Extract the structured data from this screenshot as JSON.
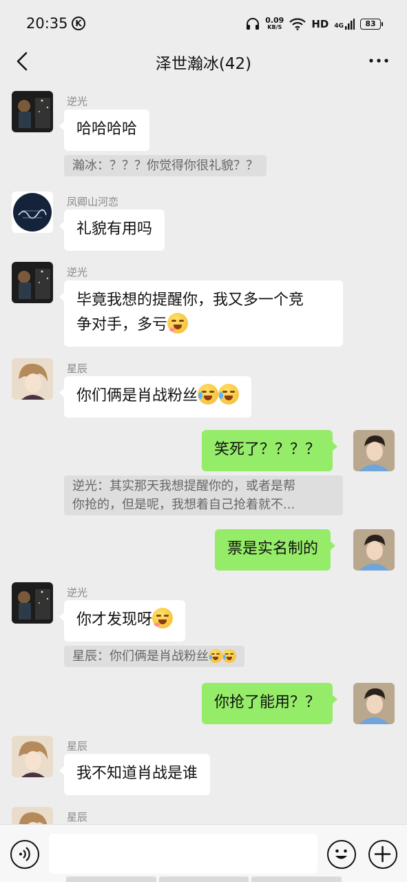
{
  "status_bar": {
    "time": "20:35",
    "k_badge": "K",
    "net_speed_value": "0.09",
    "net_speed_unit": "KB/S",
    "hd_label": "HD",
    "signal_label": "4G",
    "battery_level": "83"
  },
  "nav": {
    "title": "泽世瀚冰(42)"
  },
  "messages": [
    {
      "sender": "逆光",
      "text": "哈哈哈哈"
    },
    {
      "quote": "瀚冰：？？？你觉得你很礼貌？？"
    },
    {
      "sender": "凤卿山河恋",
      "text": "礼貌有用吗"
    },
    {
      "sender": "逆光",
      "text_line1": "毕竟我想的提醒你，我又多一个竞",
      "text_line2": "争对手，多亏"
    },
    {
      "sender": "星辰",
      "text": "你们俩是肖战粉丝"
    },
    {
      "text": "笑死了？？？？"
    },
    {
      "quote_line1": "逆光：其实那天我想提醒你的，或者是帮",
      "quote_line2": "你抢的，但是呢，我想着自己抢着就不..."
    },
    {
      "text": "票是实名制的"
    },
    {
      "sender": "逆光",
      "text": "你才发现呀"
    },
    {
      "quote": "星辰：你们俩是肖战粉丝"
    },
    {
      "text": "你抢了能用？？"
    },
    {
      "sender": "星辰",
      "text": "我不知道肖战是谁"
    },
    {
      "sender": "星辰"
    }
  ],
  "input": {
    "value": ""
  },
  "colors": {
    "chat_background": "#EDEDED",
    "own_bubble": "#95EC69",
    "other_bubble": "#FFFFFF"
  },
  "icons": {
    "back": "chevron-left-icon",
    "more": "more-horizontal-icon",
    "voice": "voice-icon",
    "emoji": "smiley-icon",
    "plus": "plus-icon",
    "emoji_grin": "grin-sweat-emoji",
    "emoji_laugh_cry": "laugh-cry-emoji"
  }
}
